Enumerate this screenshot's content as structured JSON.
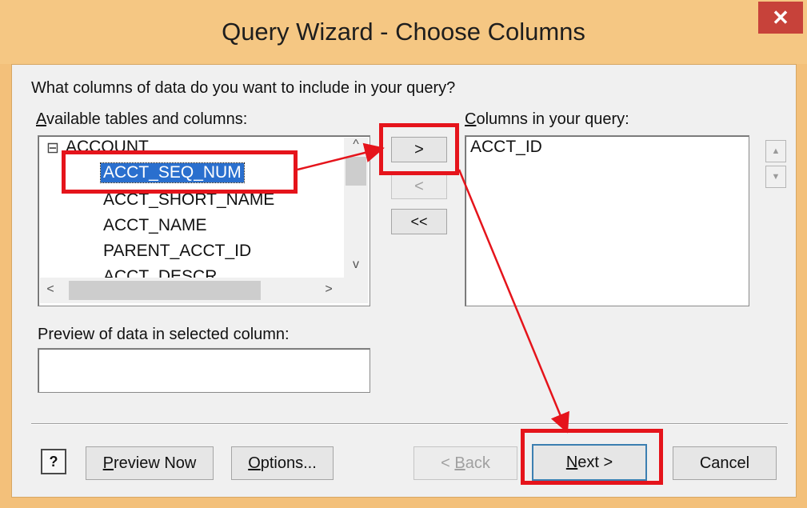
{
  "window": {
    "title": "Query Wizard - Choose Columns",
    "close_glyph": "✕"
  },
  "prompt": "What columns of data do you want to include in your query?",
  "available": {
    "label": "Available tables and columns:",
    "accelerator": "A",
    "label_rest": "vailable tables and columns:",
    "tree_toggle": "⊟",
    "table": "ACCOUNT",
    "columns": [
      "ACCT_SEQ_NUM",
      "ACCT_SHORT_NAME",
      "ACCT_NAME",
      "PARENT_ACCT_ID",
      "ACCT_DESCR"
    ],
    "selected": "ACCT_SEQ_NUM"
  },
  "query_columns": {
    "label": "Columns in your query:",
    "accelerator": "C",
    "label_rest": "olumns in your query:",
    "items": [
      "ACCT_ID"
    ]
  },
  "move_buttons": {
    "add": ">",
    "remove": "<",
    "remove_all": "<<"
  },
  "order_buttons": {
    "up": "▲",
    "down": "▼"
  },
  "preview": {
    "label": "Preview of data in selected column:",
    "value": ""
  },
  "footer": {
    "help": "?",
    "preview_now": "Preview Now",
    "preview_now_acc": "P",
    "preview_now_rest": "review Now",
    "options": "Options...",
    "options_acc": "O",
    "options_rest": "ptions...",
    "back": "< Back",
    "back_pre": "< ",
    "back_acc": "B",
    "back_rest": "ack",
    "next_acc": "N",
    "next_rest": "ext >",
    "cancel": "Cancel"
  },
  "scroll_glyphs": {
    "up": "^",
    "down": "v",
    "left": "<",
    "right": ">"
  },
  "annotation_color": "#e5141b"
}
